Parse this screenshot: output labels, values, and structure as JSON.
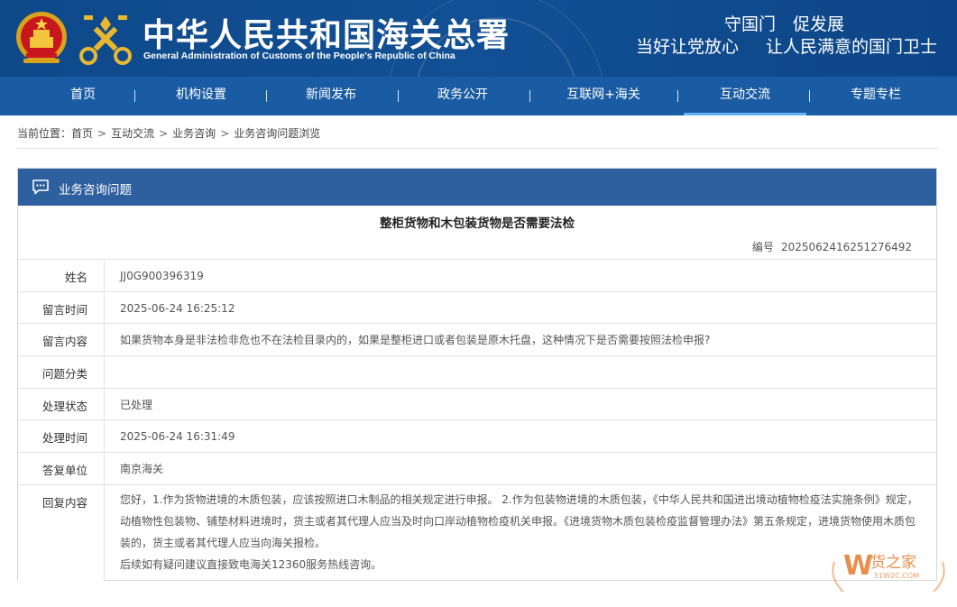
{
  "header": {
    "title": "中华人民共和国海关总署",
    "subtitle": "General Administration of Customs of the People's Republic of China",
    "slogan_line1": "守国门　促发展",
    "slogan_line2a": "当好让党放心",
    "slogan_line2b": "让人民满意的国门卫士"
  },
  "nav": {
    "items": [
      {
        "label": "首页"
      },
      {
        "label": "机构设置"
      },
      {
        "label": "新闻发布"
      },
      {
        "label": "政务公开"
      },
      {
        "label": "互联网+海关"
      },
      {
        "label": "互动交流"
      },
      {
        "label": "专题专栏"
      }
    ],
    "active": "互动交流"
  },
  "breadcrumb": {
    "prefix": "当前位置：",
    "items": [
      "首页",
      "互动交流",
      "业务咨询",
      "业务咨询问题浏览"
    ],
    "separator": ">"
  },
  "panel": {
    "title": "业务咨询问题",
    "question_title": "整柜货物和木包装货物是否需要法检",
    "code_label": "编号",
    "code_value": "2025062416251276492"
  },
  "rows": [
    {
      "label": "姓名",
      "value": "JJ0G900396319"
    },
    {
      "label": "留言时间",
      "value": "2025-06-24 16:25:12"
    },
    {
      "label": "留言内容",
      "value": "如果货物本身是非法检非危也不在法检目录内的，如果是整柜进口或者包装是原木托盘，这种情况下是否需要按照法检申报?"
    },
    {
      "label": "问题分类",
      "value": ""
    },
    {
      "label": "处理状态",
      "value": "已处理"
    },
    {
      "label": "处理时间",
      "value": "2025-06-24 16:31:49"
    },
    {
      "label": "答复单位",
      "value": "南京海关"
    },
    {
      "label": "回复内容",
      "paragraph1": "您好，1.作为货物进境的木质包装，应该按照进口木制品的相关规定进行申报。 2.作为包装物进境的木质包装，《中华人民共和国进出境动植物检疫法实施条例》规定，动植物性包装物、铺垫材料进境时，货主或者其代理人应当及时向口岸动植物检疫机关申报。《进境货物木质包装检疫监督管理办法》第五条规定，进境货物使用木质包装的，货主或者其代理人应当向海关报检。",
      "paragraph2": "后续如有疑问建议直接致电海关12360服务热线咨询。"
    }
  ],
  "watermark": {
    "brand": "货之家",
    "domain": "51W2C.COM"
  },
  "colors": {
    "header_bg": "#124f94",
    "nav_bg": "#1a5ca3",
    "panel_head_bg": "#2e5f9f",
    "active_underline": "#5fb5f0"
  }
}
